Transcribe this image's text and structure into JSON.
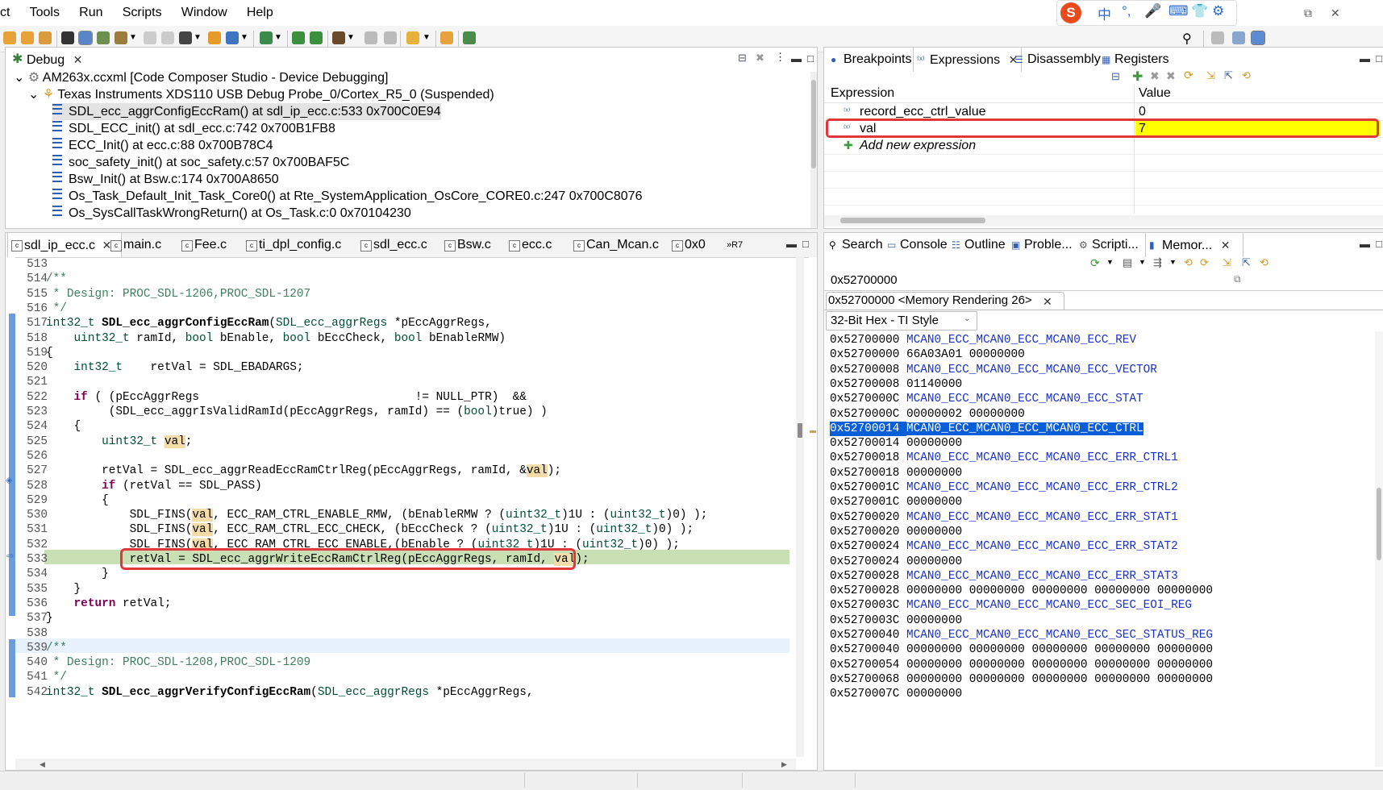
{
  "menu": [
    "ct",
    "Tools",
    "Run",
    "Scripts",
    "Window",
    "Help"
  ],
  "ime": {
    "logo": "S",
    "glyphs": [
      "中",
      "°,",
      "🎤",
      "⌨",
      "👕",
      "⚙"
    ]
  },
  "debug": {
    "tab_label": "Debug",
    "tree": [
      {
        "text": "AM263x.ccxml [Code Composer Studio - Device Debugging]",
        "level": 0
      },
      {
        "text": "Texas Instruments XDS110 USB Debug Probe_0/Cortex_R5_0 (Suspended)",
        "level": 1
      },
      {
        "text": "SDL_ecc_aggrConfigEccRam() at sdl_ip_ecc.c:533 0x700C0E94",
        "level": 2,
        "selected": true
      },
      {
        "text": "SDL_ECC_init() at sdl_ecc.c:742 0x700B1FB8",
        "level": 2
      },
      {
        "text": "ECC_Init() at ecc.c:88 0x700B78C4",
        "level": 2
      },
      {
        "text": "soc_safety_init() at soc_safety.c:57 0x700BAF5C",
        "level": 2
      },
      {
        "text": "Bsw_Init() at Bsw.c:174 0x700A8650",
        "level": 2
      },
      {
        "text": "Os_Task_Default_Init_Task_Core0() at Rte_SystemApplication_OsCore_CORE0.c:247 0x700C8076",
        "level": 2
      },
      {
        "text": "Os_SysCallTaskWrongReturn() at Os_Task.c:0 0x70104230",
        "level": 2
      }
    ]
  },
  "expressions": {
    "tabs": [
      "Breakpoints",
      "Expressions",
      "Disassembly",
      "Registers"
    ],
    "col_expression": "Expression",
    "col_value": "Value",
    "rows": [
      {
        "name": "record_ecc_ctrl_value",
        "value": "0"
      },
      {
        "name": "val",
        "value": "7",
        "highlighted": true
      }
    ],
    "add_new": "Add new expression"
  },
  "editor": {
    "tabs": [
      "sdl_ip_ecc.c",
      "main.c",
      "Fee.c",
      "ti_dpl_config.c",
      "sdl_ecc.c",
      "Bsw.c",
      "ecc.c",
      "Can_Mcan.c",
      "0x0",
      "»R7"
    ],
    "line_numbers": [
      "513",
      "514",
      "515",
      "516",
      "517",
      "518",
      "519",
      "520",
      "521",
      "522",
      "523",
      "524",
      "525",
      "526",
      "527",
      "528",
      "529",
      "530",
      "531",
      "532",
      "533",
      "534",
      "535",
      "536",
      "537",
      "538",
      "539",
      "540",
      "541",
      "542"
    ],
    "line_texts": [
      "",
      "/**",
      " * Design: PROC_SDL-1206,PROC_SDL-1207",
      " */",
      "int32_t SDL_ecc_aggrConfigEccRam(SDL_ecc_aggrRegs *pEccAggrRegs,",
      "    uint32_t ramId, bool bEnable, bool bEccCheck, bool bEnableRMW)",
      "{",
      "    int32_t    retVal = SDL_EBADARGS;",
      "",
      "    if ( (pEccAggrRegs                               != NULL_PTR)  &&",
      "         (SDL_ecc_aggrIsValidRamId(pEccAggrRegs, ramId) == (bool)true) )",
      "    {",
      "        uint32_t val;",
      "",
      "        retVal = SDL_ecc_aggrReadEccRamCtrlReg(pEccAggrRegs, ramId, &val);",
      "        if (retVal == SDL_PASS)",
      "        {",
      "            SDL_FINS(val, ECC_RAM_CTRL_ENABLE_RMW, (bEnableRMW ? (uint32_t)1U : (uint32_t)0) );",
      "            SDL_FINS(val, ECC_RAM_CTRL_ECC_CHECK, (bEccCheck ? (uint32_t)1U : (uint32_t)0) );",
      "            SDL_FINS(val, ECC_RAM_CTRL_ECC_ENABLE,(bEnable ? (uint32_t)1U : (uint32_t)0) );",
      "            retVal = SDL_ecc_aggrWriteEccRamCtrlReg(pEccAggrRegs, ramId, val);",
      "        }",
      "    }",
      "    return retVal;",
      "}",
      "",
      "/**",
      " * Design: PROC_SDL-1208,PROC_SDL-1209",
      " */",
      "int32_t SDL_ecc_aggrVerifyConfigEccRam(SDL_ecc_aggrRegs *pEccAggrRegs,"
    ],
    "current_line": "533"
  },
  "memory": {
    "tabs": [
      "Search",
      "Console",
      "Outline",
      "Proble...",
      "Scripti...",
      "Memor..."
    ],
    "address_input": "0x52700000",
    "rendering_tab": "0x52700000 <Memory Rendering 26>",
    "format": "32-Bit Hex - TI Style",
    "rows": [
      {
        "addr": "0x52700000",
        "text": "MCAN0_ECC_MCAN0_ECC_MCAN0_ECC_REV",
        "label": true
      },
      {
        "addr": "0x52700000",
        "text": "66A03A01 00000000"
      },
      {
        "addr": "0x52700008",
        "text": "MCAN0_ECC_MCAN0_ECC_MCAN0_ECC_VECTOR",
        "label": true
      },
      {
        "addr": "0x52700008",
        "text": "01140000"
      },
      {
        "addr": "0x5270000C",
        "text": "MCAN0_ECC_MCAN0_ECC_MCAN0_ECC_STAT",
        "label": true
      },
      {
        "addr": "0x5270000C",
        "text": "00000002 00000000"
      },
      {
        "addr": "0x52700014",
        "text": "MCAN0_ECC_MCAN0_ECC_MCAN0_ECC_CTRL",
        "label": true,
        "selected": true
      },
      {
        "addr": "0x52700014",
        "text": "00000000"
      },
      {
        "addr": "0x52700018",
        "text": "MCAN0_ECC_MCAN0_ECC_MCAN0_ECC_ERR_CTRL1",
        "label": true
      },
      {
        "addr": "0x52700018",
        "text": "00000000"
      },
      {
        "addr": "0x5270001C",
        "text": "MCAN0_ECC_MCAN0_ECC_MCAN0_ECC_ERR_CTRL2",
        "label": true
      },
      {
        "addr": "0x5270001C",
        "text": "00000000"
      },
      {
        "addr": "0x52700020",
        "text": "MCAN0_ECC_MCAN0_ECC_MCAN0_ECC_ERR_STAT1",
        "label": true
      },
      {
        "addr": "0x52700020",
        "text": "00000000"
      },
      {
        "addr": "0x52700024",
        "text": "MCAN0_ECC_MCAN0_ECC_MCAN0_ECC_ERR_STAT2",
        "label": true
      },
      {
        "addr": "0x52700024",
        "text": "00000000"
      },
      {
        "addr": "0x52700028",
        "text": "MCAN0_ECC_MCAN0_ECC_MCAN0_ECC_ERR_STAT3",
        "label": true
      },
      {
        "addr": "0x52700028",
        "text": "00000000 00000000 00000000 00000000 00000000"
      },
      {
        "addr": "0x5270003C",
        "text": "MCAN0_ECC_MCAN0_ECC_MCAN0_ECC_SEC_EOI_REG",
        "label": true
      },
      {
        "addr": "0x5270003C",
        "text": "00000000"
      },
      {
        "addr": "0x52700040",
        "text": "MCAN0_ECC_MCAN0_ECC_MCAN0_ECC_SEC_STATUS_REG",
        "label": true
      },
      {
        "addr": "0x52700040",
        "text": "00000000 00000000 00000000 00000000 00000000"
      },
      {
        "addr": "0x52700054",
        "text": "00000000 00000000 00000000 00000000 00000000"
      },
      {
        "addr": "0x52700068",
        "text": "00000000 00000000 00000000 00000000 00000000"
      },
      {
        "addr": "0x5270007C",
        "text": "00000000"
      }
    ]
  },
  "colors": {
    "annotation": "#e0383a",
    "selection": "#0a5fd8",
    "current_line": "#c9e0b4",
    "value_highlight": "#ffff00"
  }
}
